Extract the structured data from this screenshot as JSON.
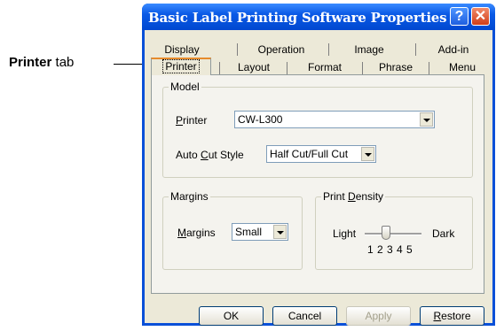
{
  "annotation": {
    "bold_text": "Printer",
    "rest_text": " tab"
  },
  "window": {
    "title": "Basic Label Printing Software Properties",
    "help_glyph": "?",
    "close_glyph": "✕"
  },
  "tabs": {
    "row1": [
      "Display",
      "Operation",
      "Image",
      "Add-in"
    ],
    "row2": [
      "Printer",
      "Layout",
      "Format",
      "Phrase",
      "Menu"
    ],
    "active": "Printer"
  },
  "model": {
    "legend": "Model",
    "printer": {
      "label_key": "P",
      "label_rest": "rinter",
      "value": "CW-L300"
    },
    "auto_cut": {
      "label_pre": "Auto ",
      "label_key": "C",
      "label_rest": "ut Style",
      "value": "Half Cut/Full Cut"
    }
  },
  "margins": {
    "legend": "Margins",
    "label_key": "M",
    "label_rest": "argins",
    "value": "Small"
  },
  "density": {
    "legend_pre": "Print ",
    "legend_key": "D",
    "legend_rest": "ensity",
    "light": "Light",
    "dark": "Dark",
    "ticks": "1 2 3 4 5",
    "level": 3
  },
  "buttons": {
    "ok": "OK",
    "cancel": "Cancel",
    "apply": "Apply",
    "restore_key": "R",
    "restore_rest": "estore"
  }
}
